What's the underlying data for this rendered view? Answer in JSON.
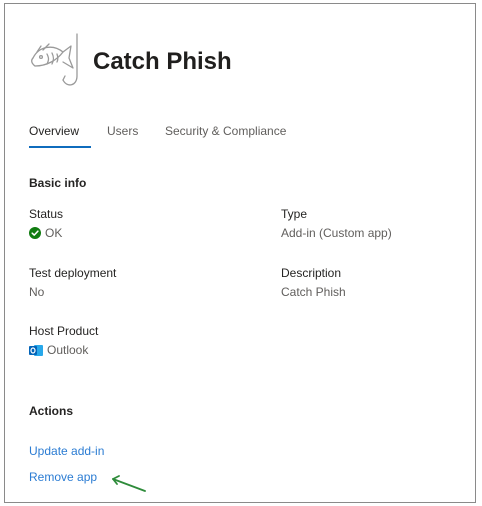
{
  "app": {
    "title": "Catch Phish"
  },
  "tabs": [
    {
      "label": "Overview",
      "active": true
    },
    {
      "label": "Users",
      "active": false
    },
    {
      "label": "Security & Compliance",
      "active": false
    }
  ],
  "basic_info": {
    "heading": "Basic info",
    "status": {
      "label": "Status",
      "value": "OK",
      "icon": "check-circle-icon",
      "color": "#107c10"
    },
    "type": {
      "label": "Type",
      "value": "Add-in (Custom app)"
    },
    "test_deployment": {
      "label": "Test deployment",
      "value": "No"
    },
    "description": {
      "label": "Description",
      "value": "Catch Phish"
    },
    "host_product": {
      "label": "Host Product",
      "value": "Outlook",
      "icon": "outlook-icon"
    }
  },
  "actions": {
    "heading": "Actions",
    "update_label": "Update add-in",
    "remove_label": "Remove app"
  },
  "colors": {
    "accent": "#0f6cbd",
    "link": "#2b7cd3",
    "arrow": "#2e8b3a"
  }
}
